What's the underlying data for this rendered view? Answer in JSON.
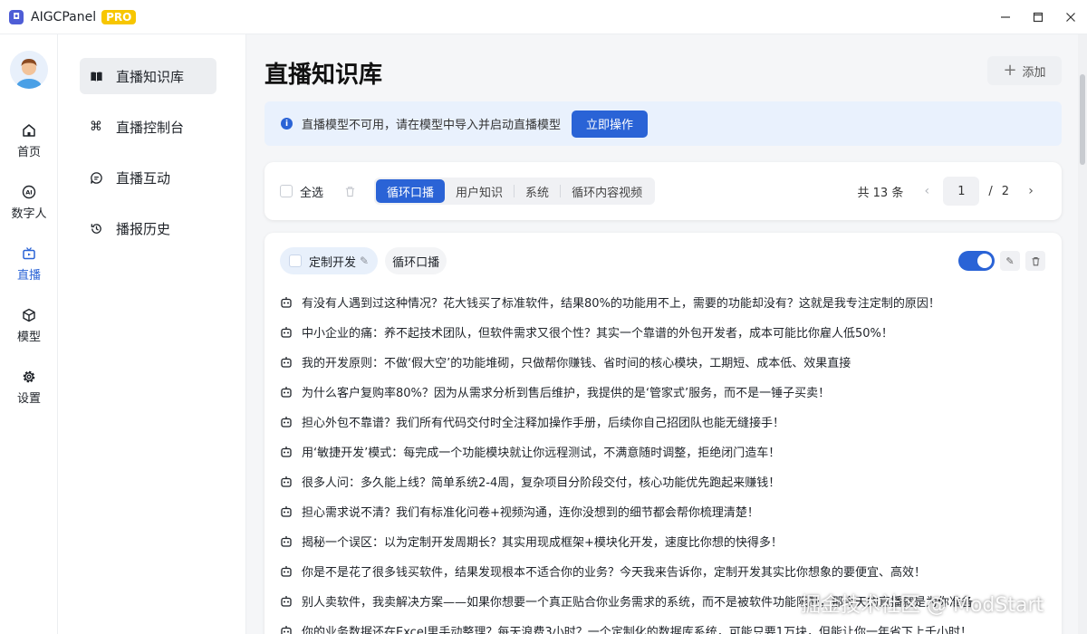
{
  "window": {
    "app_name": "AIGCPanel",
    "badge": "PRO",
    "controls": [
      "minimize-icon",
      "maximize-icon",
      "close-icon"
    ]
  },
  "rail": {
    "items": [
      {
        "label": "首页",
        "icon": "home-icon",
        "active": false
      },
      {
        "label": "数字人",
        "icon": "ai-icon",
        "active": false
      },
      {
        "label": "直播",
        "icon": "tv-icon",
        "active": true
      },
      {
        "label": "模型",
        "icon": "cube-icon",
        "active": false
      },
      {
        "label": "设置",
        "icon": "gear-icon",
        "active": false
      }
    ]
  },
  "subnav": {
    "items": [
      {
        "label": "直播知识库",
        "icon": "book-icon",
        "active": true
      },
      {
        "label": "直播控制台",
        "icon": "command-icon",
        "active": false
      },
      {
        "label": "直播互动",
        "icon": "chat-icon",
        "active": false
      },
      {
        "label": "播报历史",
        "icon": "history-icon",
        "active": false
      }
    ]
  },
  "main": {
    "title": "直播知识库",
    "add_label": "添加",
    "alert": {
      "text": "直播模型不可用，请在模型中导入并启动直播模型",
      "button": "立即操作"
    },
    "toolbar": {
      "select_all": "全选",
      "tabs": [
        "循环口播",
        "用户知识",
        "系统",
        "循环内容视频"
      ],
      "active_tab": "循环口播",
      "total": "共 13 条",
      "page": "1",
      "page_sep": "/",
      "page_count": "2"
    },
    "card": {
      "tag_primary": "定制开发",
      "tag_secondary": "循环口播",
      "enabled": true,
      "lines": [
        "有没有人遇到过这种情况？花大钱买了标准软件，结果80%的功能用不上，需要的功能却没有？这就是我专注定制的原因！",
        "中小企业的痛：养不起技术团队，但软件需求又很个性？其实一个靠谱的外包开发者，成本可能比你雇人低50%！",
        "我的开发原则：不做‘假大空’的功能堆砌，只做帮你赚钱、省时间的核心模块，工期短、成本低、效果直接",
        "为什么客户复购率80%？因为从需求分析到售后维护，我提供的是‘管家式’服务，而不是一锤子买卖！",
        "担心外包不靠谱？我们所有代码交付时全注释加操作手册，后续你自己招团队也能无缝接手！",
        "用‘敏捷开发’模式：每完成一个功能模块就让你远程测试，不满意随时调整，拒绝闭门造车！",
        "很多人问：多久能上线？简单系统2-4周，复杂项目分阶段交付，核心功能优先跑起来赚钱！",
        "担心需求说不清？我们有标准化问卷+视频沟通，连你没想到的细节都会帮你梳理清楚！",
        "揭秘一个误区：以为定制开发周期长？其实用现成框架+模块化开发，速度比你想的快得多！",
        "你是不是花了很多钱买软件，结果发现根本不适合你的业务？今天我来告诉你，定制开发其实比你想象的要便宜、高效！",
        "别人卖软件，我卖解决方案——如果你想要一个真正贴合你业务需求的系统，而不是被软件功能限制，那今天的直播就是为你准备",
        "你的业务数据还在Excel里手动整理？每天浪费3小时？一个定制化的数据库系统，可能只要1万块，但能让你一年省下上千小时！"
      ]
    }
  },
  "watermark": "掘金技术社区 @ ModStart",
  "colors": {
    "accent": "#2a63d6",
    "badge": "#f7c600",
    "alert_bg": "#e9f1fd"
  }
}
